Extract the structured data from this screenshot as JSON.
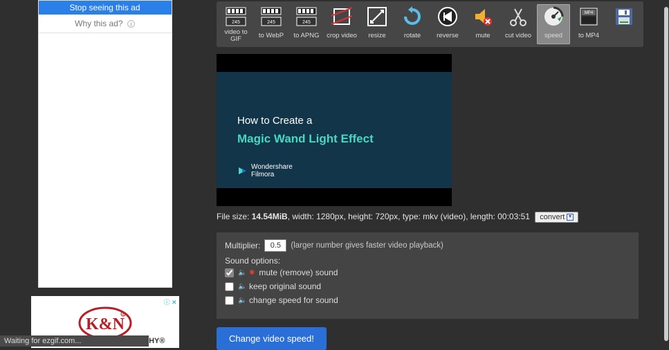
{
  "ads": {
    "stop_label": "Stop seeing this ad",
    "why_label": "Why this ad?",
    "kn_subtext": ".THY®"
  },
  "toolbar": {
    "items": [
      {
        "label": "video to GIF"
      },
      {
        "label": "to WebP"
      },
      {
        "label": "to APNG"
      },
      {
        "label": "crop video"
      },
      {
        "label": "resize"
      },
      {
        "label": "rotate"
      },
      {
        "label": "reverse"
      },
      {
        "label": "mute"
      },
      {
        "label": "cut video"
      },
      {
        "label": "speed"
      },
      {
        "label": "to MP4"
      },
      {
        "label": ""
      }
    ],
    "active_index": 9
  },
  "preview": {
    "line1": "How to Create a",
    "line2": "Magic Wand Light Effect",
    "brand_line1": "Wondershare",
    "brand_line2": "Filmora"
  },
  "fileinfo": {
    "prefix": "File size: ",
    "size": "14.54MiB",
    "rest": ", width: 1280px, height: 720px, type: mkv (video), length: 00:03:51",
    "convert_label": "convert"
  },
  "options": {
    "multiplier_label": "Multiplier:",
    "multiplier_value": "0.5",
    "multiplier_hint": "(larger number gives faster video playback)",
    "sound_title": "Sound options:",
    "opt1": "mute (remove) sound",
    "opt2": "keep original sound",
    "opt3": "change speed for sound"
  },
  "action_button": "Change video speed!",
  "status_text": "Waiting for ezgif.com..."
}
